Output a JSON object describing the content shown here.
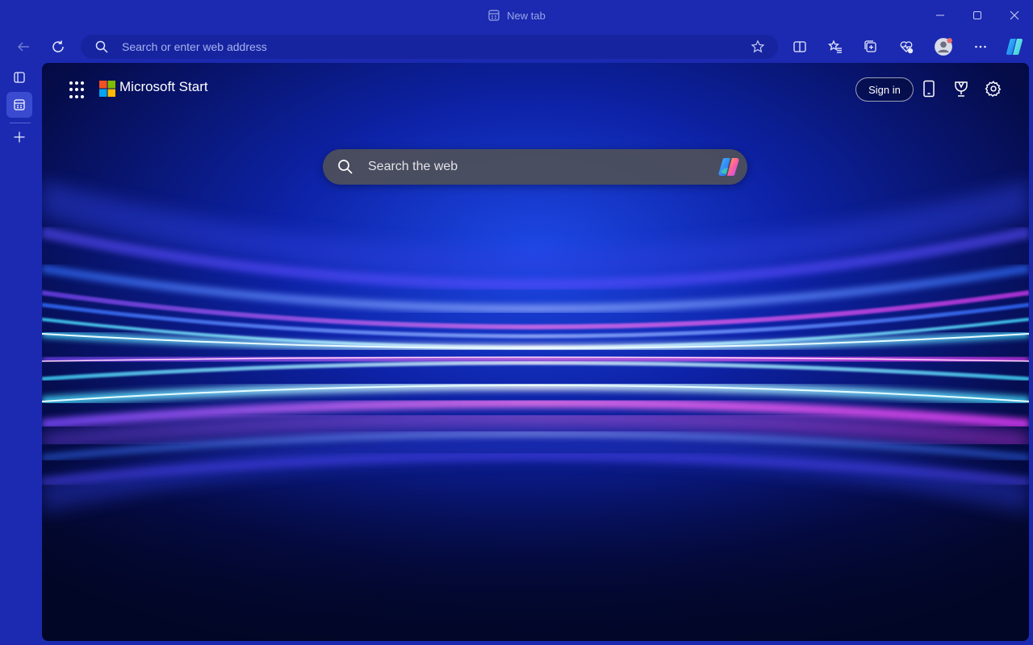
{
  "window": {
    "tab_title": "New tab"
  },
  "icons": {
    "tab": "tab-page-icon",
    "minimize": "minimize-icon",
    "maximize": "maximize-icon",
    "close": "close-icon",
    "back": "back-arrow-icon",
    "refresh": "refresh-icon",
    "search": "search-icon",
    "favorite": "star-icon",
    "split_screen": "split-screen-icon",
    "favorites": "favorites-icon",
    "collections": "collections-icon",
    "browser_essentials": "heart-pulse-icon",
    "profile": "avatar-icon",
    "more": "more-icon",
    "copilot": "copilot-icon",
    "apps": "app-launcher-icon",
    "phone": "phone-icon",
    "rewards": "rewards-trophy-icon",
    "settings": "gear-icon"
  },
  "toolbar": {
    "address_placeholder": "Search or enter web address"
  },
  "start_page": {
    "brand": "Microsoft Start",
    "sign_in": "Sign in",
    "search_placeholder": "Search the web"
  },
  "colors": {
    "frame": "#1b2ab0",
    "address_bg": "#1624a0",
    "accent_active_tab": "#3a4bd0",
    "logo_red": "#f25022",
    "logo_green": "#7fba00",
    "logo_blue": "#00a4ef",
    "logo_yellow": "#ffb900"
  }
}
